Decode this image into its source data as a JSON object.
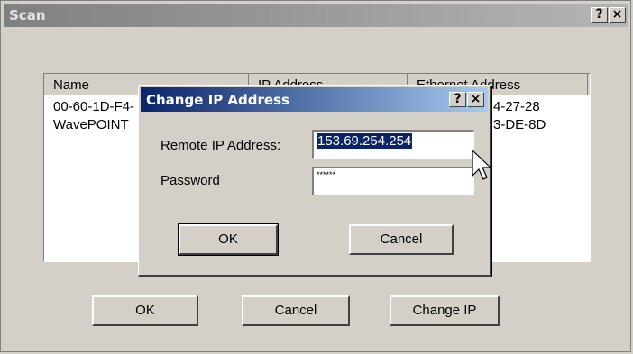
{
  "scan_window": {
    "title": "Scan",
    "help_button": "?",
    "close_button": "×",
    "list": {
      "columns": [
        "Name",
        "IP Address",
        "Ethernet Address"
      ],
      "rows": [
        {
          "name": "00-60-1D-F4-",
          "ethernet": "4-27-28"
        },
        {
          "name": "WavePOINT",
          "ethernet": "3-DE-8D"
        }
      ]
    },
    "buttons": {
      "ok": "OK",
      "cancel": "Cancel",
      "change_ip": "Change IP"
    }
  },
  "dialog": {
    "title": "Change IP Address",
    "help_button": "?",
    "close_button": "×",
    "remote_ip_label": "Remote IP Address:",
    "remote_ip_value": "153.69.254.254",
    "password_label": "Password",
    "password_value": "******",
    "buttons": {
      "ok": "OK",
      "cancel": "Cancel"
    }
  },
  "colors": {
    "active_titlebar": "#0a246a",
    "inactive_titlebar": "#808080",
    "face": "#d4d0c8"
  }
}
